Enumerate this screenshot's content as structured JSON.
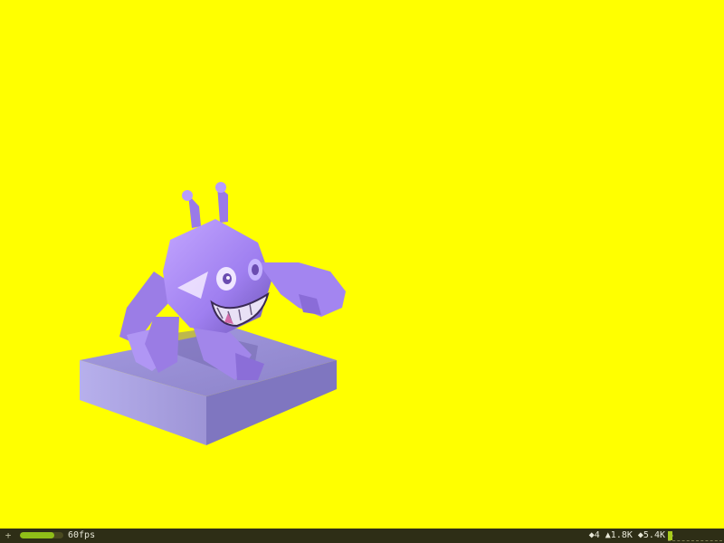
{
  "stats": {
    "expand_symbol": "+",
    "fps_label": "60fps",
    "fps_bar_fraction": 0.8,
    "meshes": "◆4",
    "triangles": "▲1.8K",
    "vertices": "◆5.4K",
    "memory_symbol": "●"
  },
  "colors": {
    "background": "#ffff00",
    "stats_bar": "#2e2e16",
    "fps_bar_fill": "#8fbe18",
    "character_body": "#a98cf0",
    "pedestal": "#9a90d8"
  }
}
